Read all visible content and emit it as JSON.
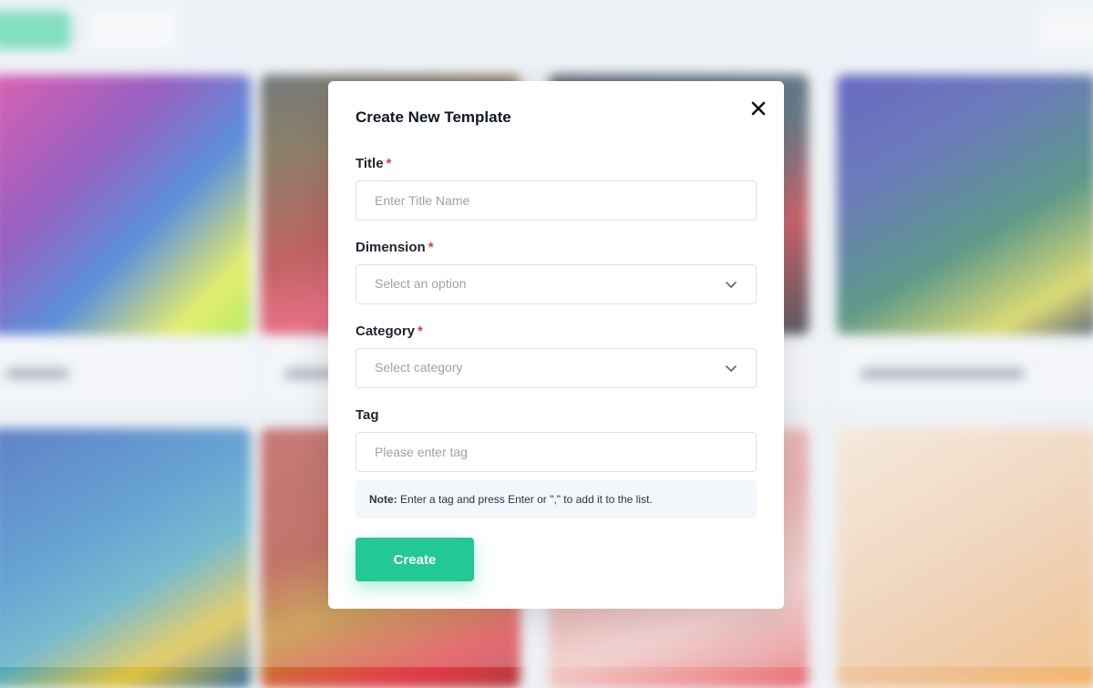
{
  "modal": {
    "title": "Create New Template",
    "fields": {
      "title": {
        "label": "Title",
        "required_mark": "*",
        "placeholder": "Enter Title Name",
        "value": ""
      },
      "dimension": {
        "label": "Dimension",
        "required_mark": "*",
        "selected": "Select an option"
      },
      "category": {
        "label": "Category",
        "required_mark": "*",
        "selected": "Select category"
      },
      "tag": {
        "label": "Tag",
        "placeholder": "Please enter tag",
        "value": ""
      }
    },
    "note": {
      "label": "Note:",
      "text": "Enter a tag and press Enter or \",\" to add it to the list."
    },
    "create_label": "Create"
  },
  "icons": {
    "close": "close-icon",
    "chevron": "chevron-down-icon"
  },
  "colors": {
    "primary": "#22c994",
    "required": "#e53935",
    "note_bg": "#f3f6fa",
    "input_border": "#dfe3e8"
  }
}
